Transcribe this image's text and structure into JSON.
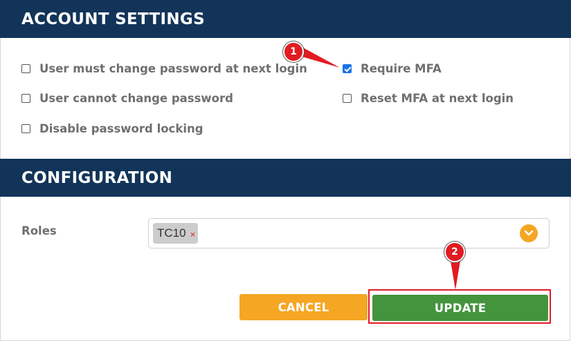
{
  "account_settings": {
    "title": "ACCOUNT SETTINGS",
    "options": [
      {
        "label": "User must change password at next login",
        "checked": false
      },
      {
        "label": "User cannot change password",
        "checked": false
      },
      {
        "label": "Disable password locking",
        "checked": false
      },
      {
        "label": "Require MFA",
        "checked": true
      },
      {
        "label": "Reset MFA at next login",
        "checked": false
      }
    ]
  },
  "configuration": {
    "title": "CONFIGURATION",
    "roles_label": "Roles",
    "roles": [
      {
        "name": "TC10",
        "remove_glyph": "×"
      }
    ],
    "dropdown_icon": "chevron-down-icon"
  },
  "actions": {
    "cancel_label": "CANCEL",
    "update_label": "UPDATE"
  },
  "annotations": {
    "callout_1": "1",
    "callout_2": "2"
  },
  "colors": {
    "header_bg": "#123459",
    "cancel_bg": "#f5a623",
    "update_bg": "#43943d",
    "callout_red": "#e21b22"
  }
}
